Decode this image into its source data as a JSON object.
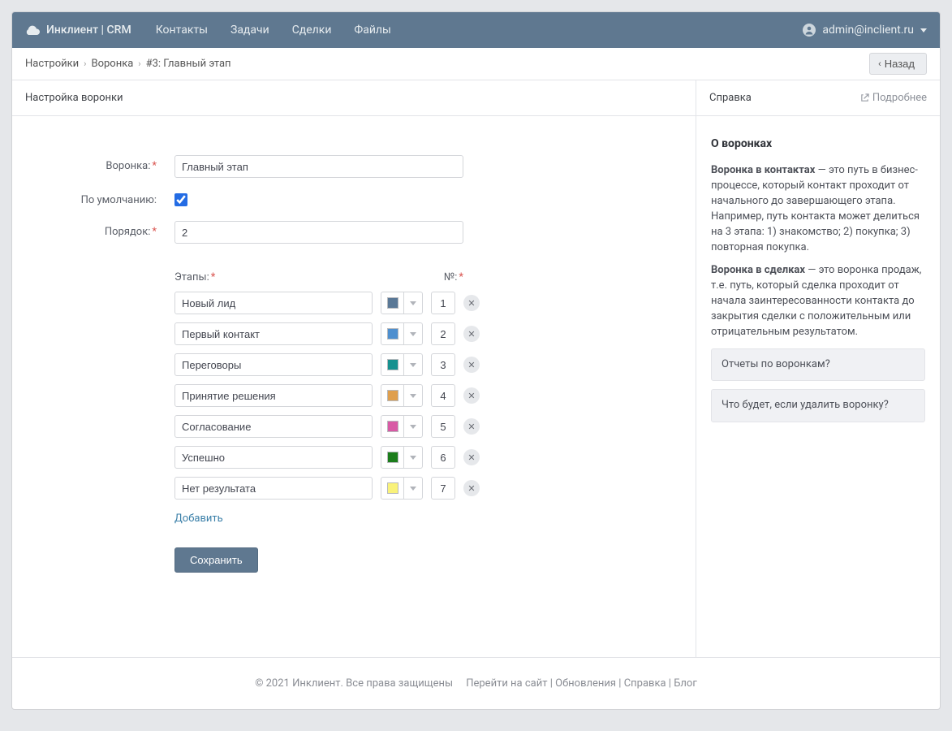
{
  "brand": "Инклиент | CRM",
  "nav": {
    "contacts": "Контакты",
    "tasks": "Задачи",
    "deals": "Сделки",
    "files": "Файлы"
  },
  "user": "admin@inclient.ru",
  "breadcrumb": {
    "a": "Настройки",
    "b": "Воронка",
    "c": "#3: Главный этап"
  },
  "back": "Назад",
  "form_title": "Настройка воронки",
  "help_title": "Справка",
  "more": "Подробнее",
  "labels": {
    "funnel": "Воронка:",
    "default": "По умолчанию:",
    "order": "Порядок:",
    "stages": "Этапы:",
    "num": "№:"
  },
  "values": {
    "funnel": "Главный этап",
    "default": true,
    "order": "2"
  },
  "stages": [
    {
      "name": "Новый лид",
      "color": "#5a7896",
      "num": "1"
    },
    {
      "name": "Первый контакт",
      "color": "#4e8fcf",
      "num": "2"
    },
    {
      "name": "Переговоры",
      "color": "#16918f",
      "num": "3"
    },
    {
      "name": "Принятие решения",
      "color": "#df9f4e",
      "num": "4"
    },
    {
      "name": "Согласование",
      "color": "#d85aa5",
      "num": "5"
    },
    {
      "name": "Успешно",
      "color": "#1b7d1b",
      "num": "6"
    },
    {
      "name": "Нет результата",
      "color": "#f9f27a",
      "num": "7"
    }
  ],
  "add": "Добавить",
  "save": "Сохранить",
  "help": {
    "heading": "О воронках",
    "p1a": "Воронка в контактах",
    "p1b": " — это путь в бизнес-процессе, который контакт проходит от начального до завершающего этапа. Например, путь контакта может делиться на 3 этапа: 1) знакомство; 2) покупка; 3) повторная покупка.",
    "p2a": "Воронка в сделках",
    "p2b": " — это воронка продаж, т.е. путь, который сделка проходит от начала заинтересованности контакта до закрытия сделки с положительным или отрицательным результатом.",
    "faq1": "Отчеты по воронкам?",
    "faq2": "Что будет, если удалить воронку?"
  },
  "footer": {
    "copyright": "© 2021 Инклиент. Все права защищены",
    "site": "Перейти на сайт",
    "updates": "Обновления",
    "help": "Справка",
    "blog": "Блог"
  }
}
